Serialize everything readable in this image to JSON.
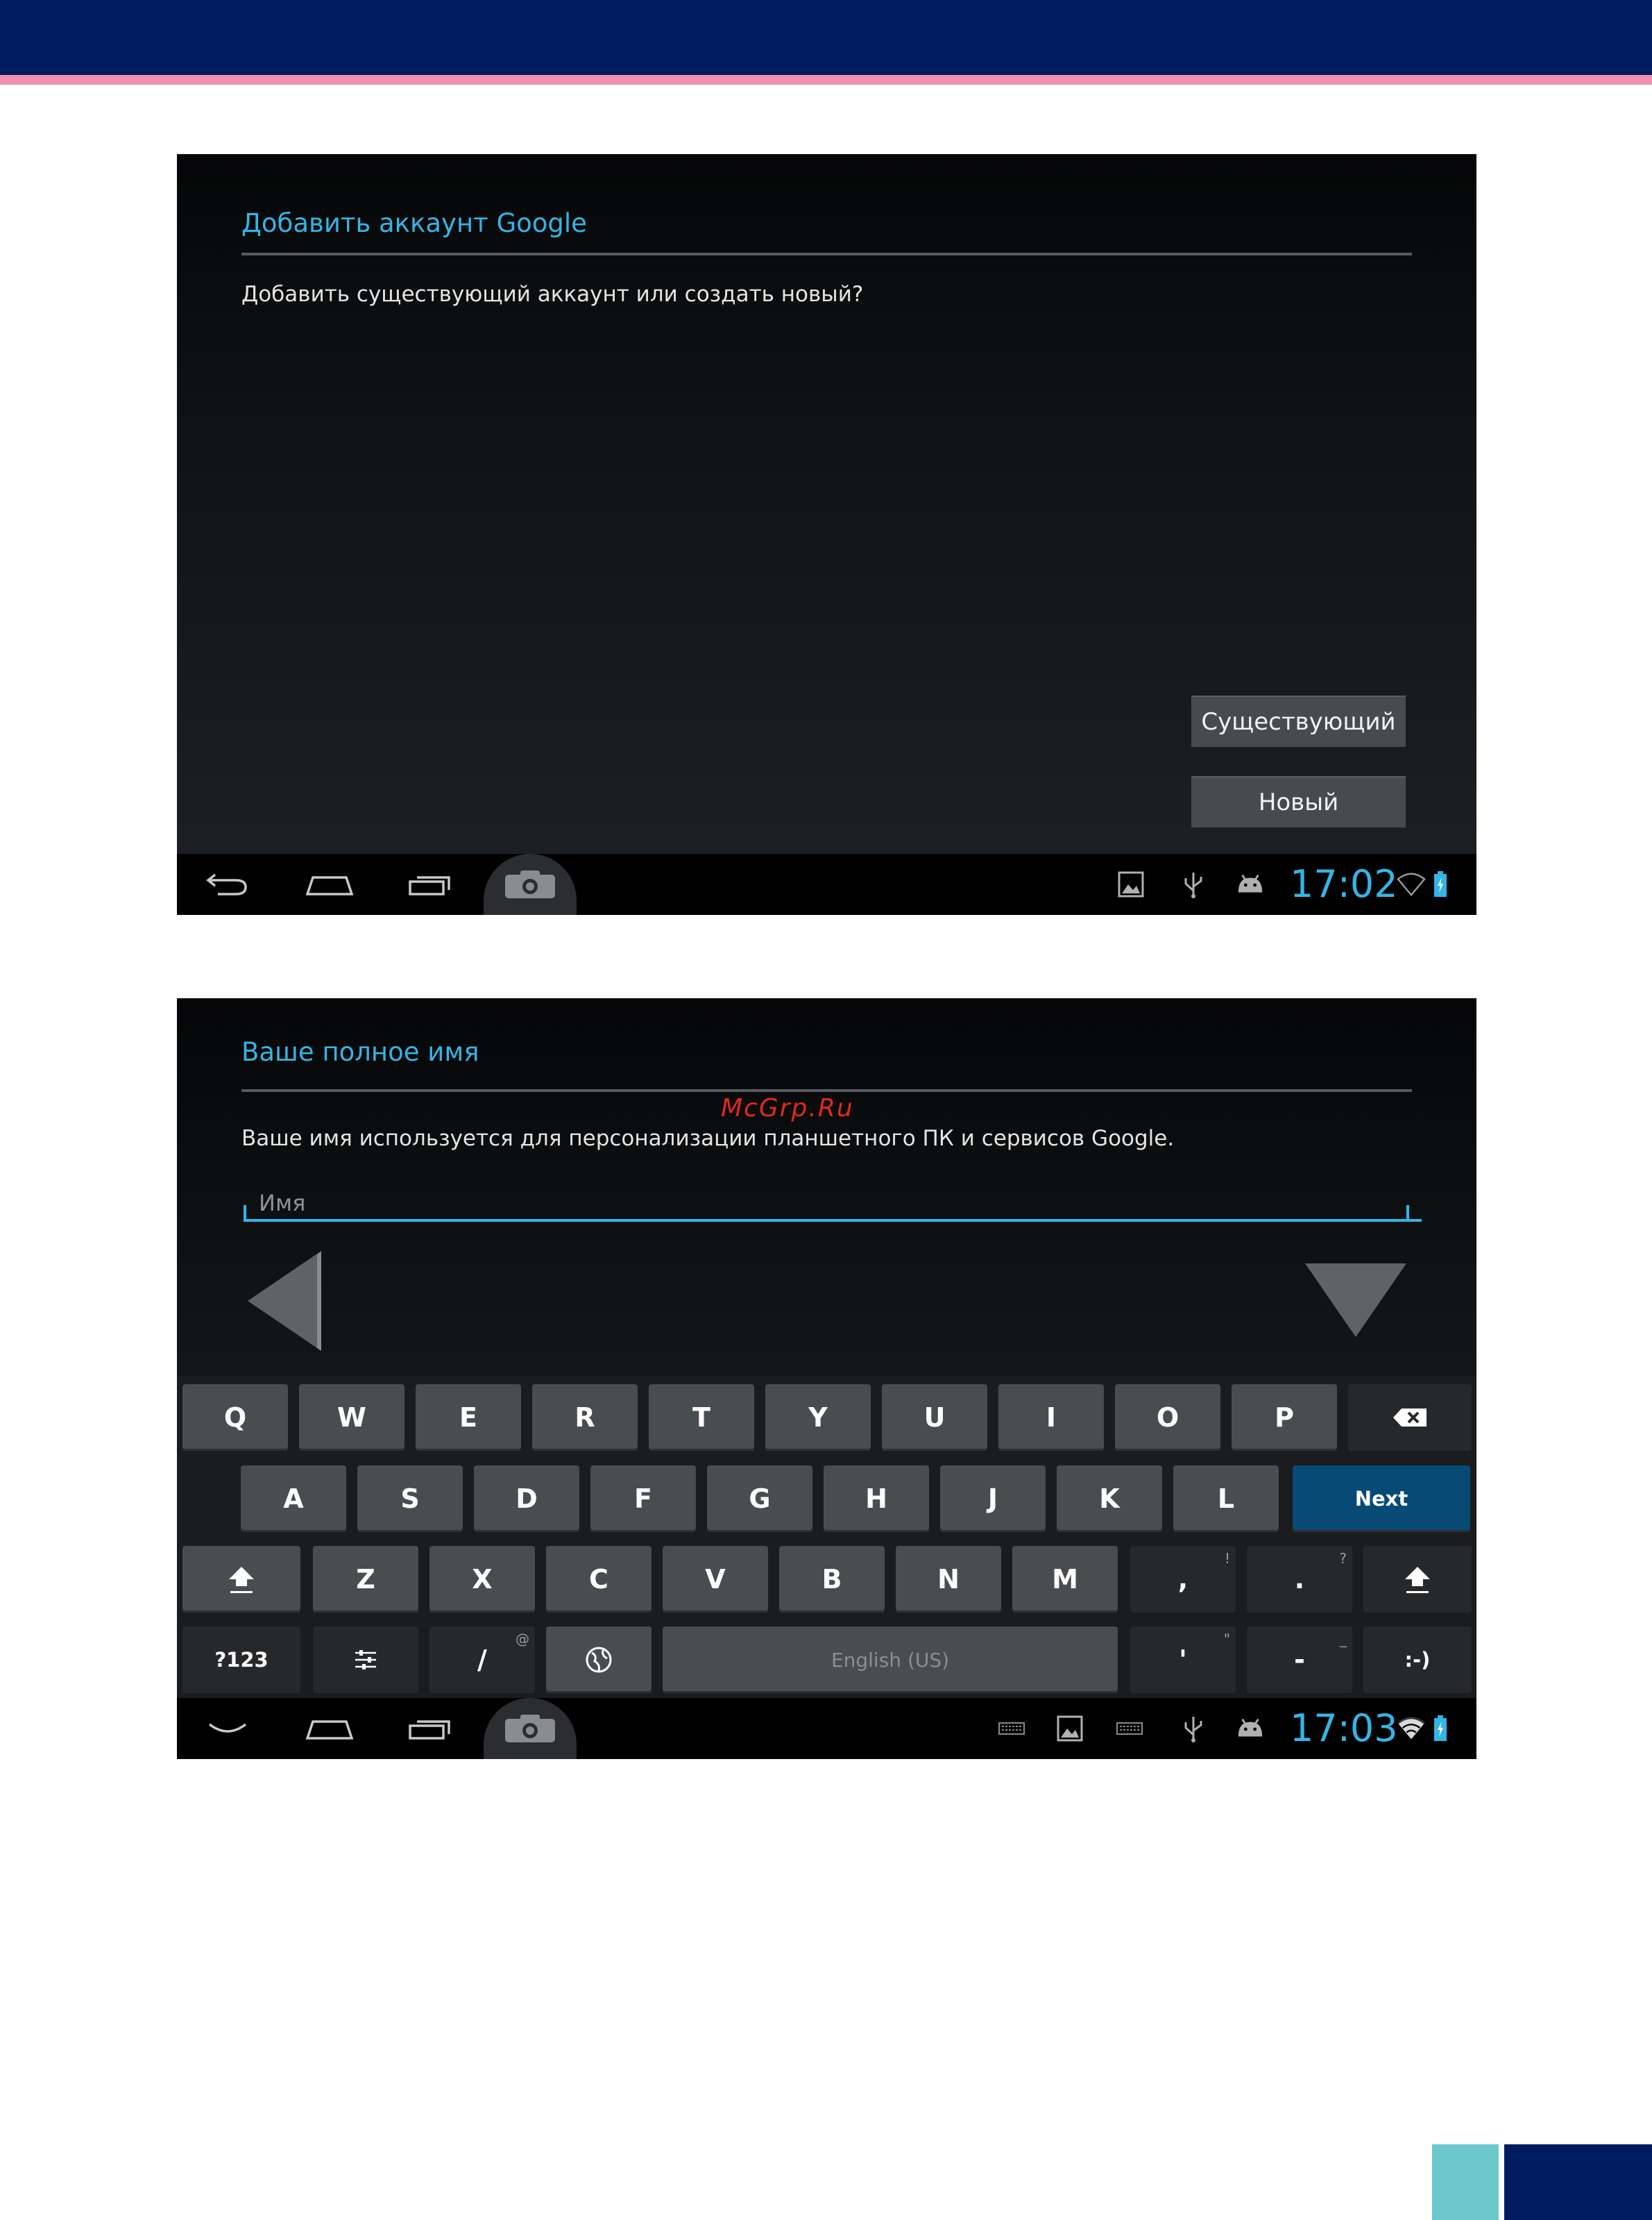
{
  "screen1": {
    "title": "Добавить аккаунт Google",
    "description": "Добавить существующий аккаунт или создать новый?",
    "buttons": {
      "existing": "Существующий",
      "new": "Новый"
    },
    "statusbar": {
      "time": "17:02"
    }
  },
  "screen2": {
    "title": "Ваше полное имя",
    "watermark": "McGrp.Ru",
    "description": "Ваше имя используется для персонализации планшетного ПК и сервисов Google.",
    "name_input": {
      "value": "",
      "placeholder": "Имя"
    },
    "keyboard": {
      "row1": [
        "Q",
        "W",
        "E",
        "R",
        "T",
        "Y",
        "U",
        "I",
        "O",
        "P"
      ],
      "row2": [
        "A",
        "S",
        "D",
        "F",
        "G",
        "H",
        "J",
        "K",
        "L"
      ],
      "next_label": "Next",
      "row3": [
        "Z",
        "X",
        "C",
        "V",
        "B",
        "N",
        "M"
      ],
      "comma": {
        "label": ",",
        "hint": "!"
      },
      "period": {
        "label": ".",
        "hint": "?"
      },
      "symbols_label": "?123",
      "slash": {
        "label": "/",
        "hint": "@"
      },
      "space_label": "English (US)",
      "apostrophe": {
        "label": "'",
        "hint": "\""
      },
      "dash": {
        "label": "-",
        "hint": "_"
      },
      "smiley_label": ":-)"
    },
    "statusbar": {
      "time": "17:03"
    }
  },
  "colors": {
    "accent": "#33b5e5",
    "page_band": "#001c60",
    "page_stripe": "#f08fb0",
    "corner_teal": "#6cc8cc",
    "next_key": "#074a75"
  },
  "icons": [
    "back-icon",
    "home-icon",
    "recents-icon",
    "camera-icon",
    "gallery-icon",
    "usb-icon",
    "android-debug-icon",
    "wifi-icon",
    "battery-icon",
    "hide-keyboard-icon",
    "keyboard-icon",
    "backspace-icon",
    "shift-icon",
    "settings-sliders-icon",
    "globe-icon"
  ]
}
